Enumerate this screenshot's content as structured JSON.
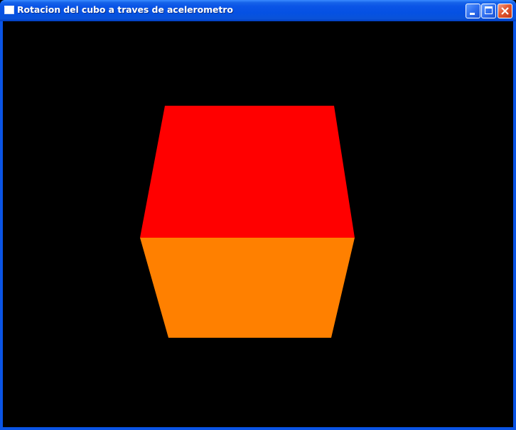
{
  "window": {
    "title": "Rotacion del cubo a traves de acelerometro",
    "icon": "app-window-icon",
    "buttons": {
      "minimize": "minimize-icon",
      "maximize": "maximize-icon",
      "close": "close-icon"
    }
  },
  "scene": {
    "background_color": "#000000",
    "cube": {
      "top_face_color": "#ff0000",
      "front_face_color": "#ff8000"
    }
  }
}
